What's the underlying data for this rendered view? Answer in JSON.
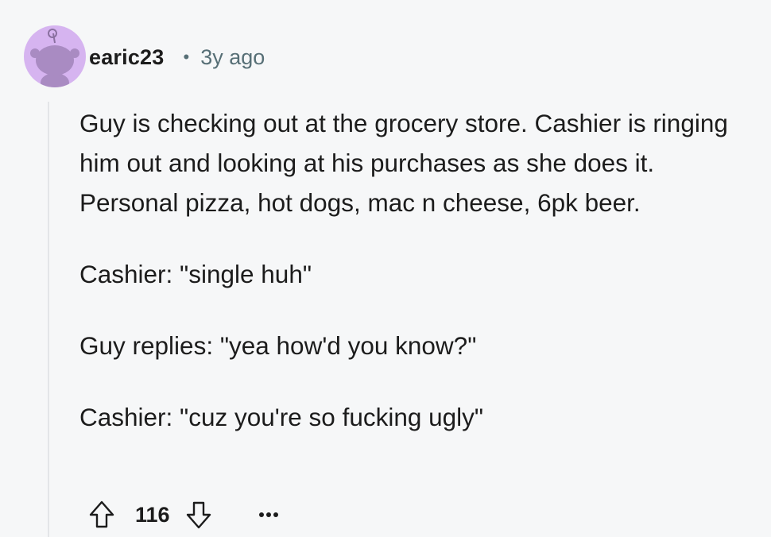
{
  "comment": {
    "author": "earic23",
    "separator": "•",
    "time_ago": "3y ago",
    "avatar_color": "#d6b4f0",
    "body_paragraphs": [
      "Guy is checking out at the grocery store. Cashier is ringing him out and looking at his purchases as she does it. Personal pizza, hot dogs, mac n cheese, 6pk beer.",
      "Cashier: \"single huh\"",
      "Guy replies: \"yea how'd you know?\"",
      "Cashier: \"cuz you're so fucking ugly\""
    ],
    "score": "116"
  },
  "icons": {
    "avatar": "reddit-snoo-avatar-icon",
    "upvote": "upvote-arrow-icon",
    "downvote": "downvote-arrow-icon",
    "more": "more-options-icon"
  }
}
